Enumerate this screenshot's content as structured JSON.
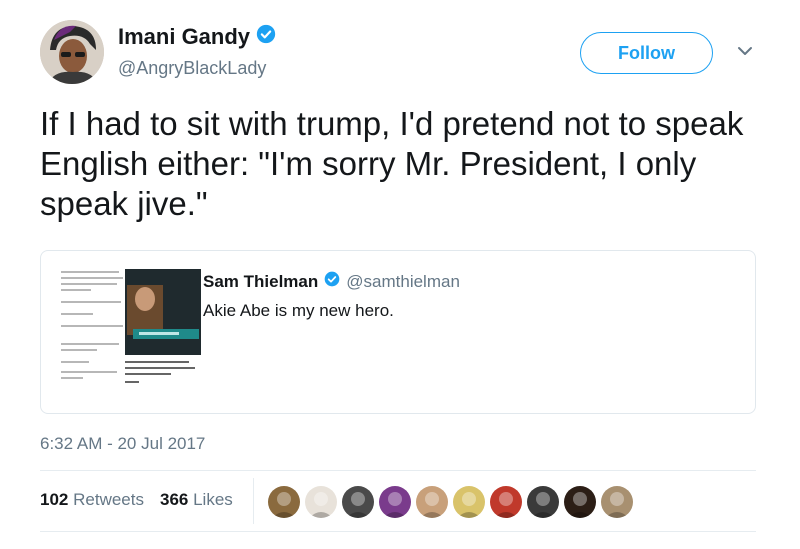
{
  "author": {
    "name": "Imani Gandy",
    "handle": "@AngryBlackLady",
    "verified_icon": "verified-badge-icon"
  },
  "header": {
    "follow_label": "Follow",
    "menu_icon": "chevron-down-icon"
  },
  "tweet": {
    "text": "If I had to sit with trump, I'd pretend not to speak English either: \"I'm sorry Mr. President, I only speak jive.\""
  },
  "quote": {
    "name": "Sam Thielman",
    "handle": "@samthielman",
    "text": "Akie Abe is my new hero."
  },
  "timestamp": "6:32 AM - 20 Jul 2017",
  "stats": {
    "retweets_count": "102",
    "retweets_label": "Retweets",
    "likes_count": "366",
    "likes_label": "Likes"
  },
  "likers": [
    {
      "color": "#8a6a3e"
    },
    {
      "color": "#e8e2da"
    },
    {
      "color": "#4a4a4a"
    },
    {
      "color": "#7a3b8c"
    },
    {
      "color": "#c8a07a"
    },
    {
      "color": "#d9c36a"
    },
    {
      "color": "#c0392b"
    },
    {
      "color": "#3a3a3a"
    },
    {
      "color": "#2c1e16"
    },
    {
      "color": "#a89070"
    }
  ],
  "colors": {
    "accent": "#1da1f2",
    "text": "#14171a",
    "muted": "#657786",
    "border": "#e1e8ed"
  }
}
